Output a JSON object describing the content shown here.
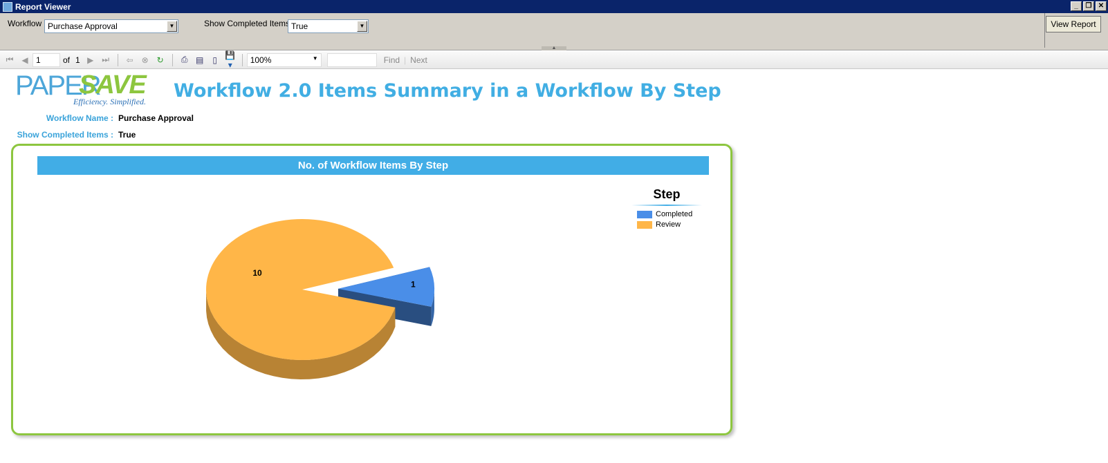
{
  "window": {
    "title": "Report Viewer",
    "buttons": [
      "_",
      "❐",
      "✕"
    ]
  },
  "params": {
    "workflow_label": "Workflow",
    "workflow_value": "Purchase Approval",
    "completed_label": "Show Completed Items",
    "completed_value": "True",
    "view_report_button": "View Report"
  },
  "toolbar": {
    "page_current": "1",
    "page_of": "of",
    "page_total": "1",
    "zoom": "100%",
    "find_value": "",
    "find_label": "Find",
    "next_label": "Next"
  },
  "report": {
    "logo_paper": "PAPER",
    "logo_save": "SAVE",
    "logo_tagline": "Efficiency. Simplified.",
    "title": "Workflow 2.0 Items Summary in a Workflow By Step",
    "workflow_name_label": "Workflow Name :",
    "workflow_name_value": "Purchase Approval",
    "show_completed_label": "Show Completed Items :",
    "show_completed_value": "True"
  },
  "chart_data": {
    "type": "pie",
    "title": "No. of Workflow Items By Step",
    "legend_title": "Step",
    "legend_position": "top-right",
    "slices": [
      {
        "name": "Completed",
        "value": 1,
        "color": "#4a8ee8",
        "exploded": true
      },
      {
        "name": "Review",
        "value": 10,
        "color": "#ffb648",
        "exploded": false
      }
    ]
  }
}
